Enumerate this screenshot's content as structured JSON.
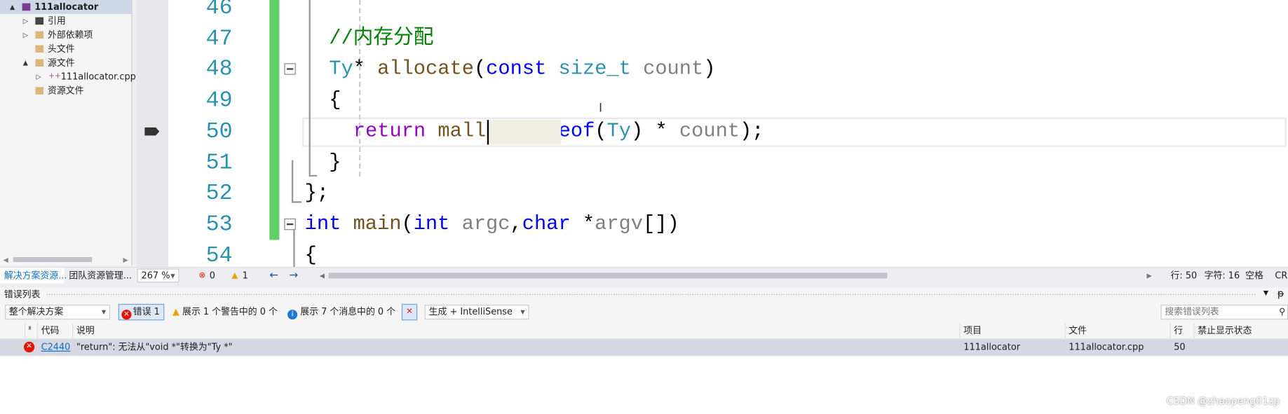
{
  "solution_explorer": {
    "items": [
      {
        "label": "111allocator",
        "expander": "▲",
        "icon": "cpp-project-icon",
        "selected": true
      },
      {
        "label": "引用",
        "expander": "▷",
        "icon": "references-icon"
      },
      {
        "label": "外部依赖项",
        "expander": "▷",
        "icon": "external-dependencies-icon"
      },
      {
        "label": "头文件",
        "expander": "",
        "icon": "folder-icon"
      },
      {
        "label": "源文件",
        "expander": "▲",
        "icon": "folder-open-icon"
      },
      {
        "label": "111allocator.cpp",
        "expander": "▷",
        "icon": "cpp-file-icon"
      },
      {
        "label": "资源文件",
        "expander": "",
        "icon": "folder-icon"
      }
    ]
  },
  "editor": {
    "line_numbers": [
      "46",
      "47",
      "48",
      "49",
      "50",
      "51",
      "52",
      "53",
      "54"
    ],
    "current_line": "50",
    "lines": [
      [],
      [
        {
          "t": "//内存分配",
          "c": "cm"
        }
      ],
      [
        {
          "t": "Ty",
          "c": "ty"
        },
        {
          "t": "* "
        },
        {
          "t": "allocate",
          "c": "fn"
        },
        {
          "t": "("
        },
        {
          "t": "const",
          "c": "kw"
        },
        {
          "t": " "
        },
        {
          "t": "size_t",
          "c": "ty"
        },
        {
          "t": " "
        },
        {
          "t": "count",
          "c": "pm"
        },
        {
          "t": ")"
        }
      ],
      [
        {
          "t": "{"
        }
      ],
      [
        {
          "t": "return",
          "c": "rt"
        },
        {
          "t": " "
        },
        {
          "t": "malloc",
          "c": "fn"
        },
        {
          "t": "("
        },
        {
          "t": "sizeof",
          "c": "kw"
        },
        {
          "t": "("
        },
        {
          "t": "Ty",
          "c": "ty"
        },
        {
          "t": ") * "
        },
        {
          "t": "count",
          "c": "pm"
        },
        {
          "t": ");"
        }
      ],
      [
        {
          "t": "}"
        }
      ],
      [
        {
          "t": "};"
        }
      ],
      [
        {
          "t": "int",
          "c": "kw"
        },
        {
          "t": " "
        },
        {
          "t": "main",
          "c": "fn"
        },
        {
          "t": "("
        },
        {
          "t": "int",
          "c": "kw"
        },
        {
          "t": " "
        },
        {
          "t": "argc",
          "c": "pm"
        },
        {
          "t": ","
        },
        {
          "t": "char",
          "c": "kw"
        },
        {
          "t": " *"
        },
        {
          "t": "argv",
          "c": "pm"
        },
        {
          "t": "[])"
        }
      ],
      [
        {
          "t": "{"
        }
      ]
    ],
    "indent": [
      0,
      2,
      2,
      2,
      4,
      2,
      0,
      0,
      0
    ]
  },
  "status": {
    "tab_solution_explorer": "解决方案资源...",
    "tab_team_explorer": "团队资源管理...",
    "zoom": "267 %",
    "errors": "0",
    "warnings": "1",
    "line": "行: 50",
    "char": "字符: 16",
    "spaces": "空格",
    "eol": "CRL"
  },
  "error_list": {
    "title": "错误列表",
    "scope": "整个解决方案",
    "errors_button": "错误 1",
    "warnings_button": "展示 1 个警告中的 0 个",
    "messages_button": "展示 7 个消息中的 0 个",
    "source": "生成 + IntelliSense",
    "search_placeholder": "搜索错误列表",
    "columns": [
      "代码",
      "说明",
      "项目",
      "文件",
      "行",
      "禁止显示状态"
    ],
    "rows": [
      {
        "code": "C2440",
        "description": "\"return\": 无法从\"void *\"转换为\"Ty *\"",
        "project": "111allocator",
        "file": "111allocator.cpp",
        "line": "50",
        "suppression": ""
      }
    ]
  },
  "watermark": "CSDN @zhaopeng01zp",
  "colors": {
    "accent": "#007acc",
    "change_bar": "#5fd068",
    "error": "#e51400",
    "line_number": "#2b91af"
  }
}
